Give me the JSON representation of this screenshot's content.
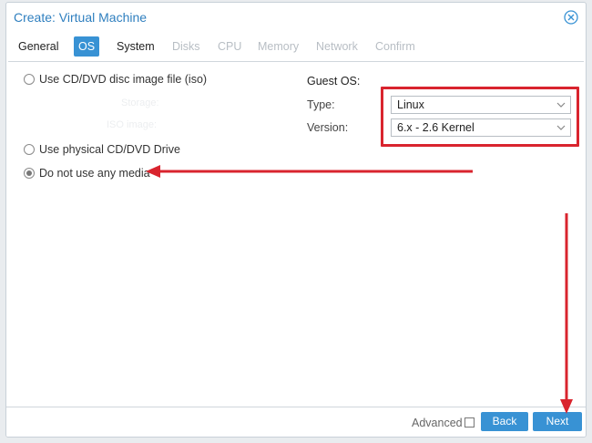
{
  "dialog": {
    "title": "Create: Virtual Machine",
    "close_icon": "close-circle-icon"
  },
  "tabs": [
    {
      "label": "General",
      "state": "enabled"
    },
    {
      "label": "OS",
      "state": "active"
    },
    {
      "label": "System",
      "state": "enabled"
    },
    {
      "label": "Disks",
      "state": "disabled"
    },
    {
      "label": "CPU",
      "state": "disabled"
    },
    {
      "label": "Memory",
      "state": "disabled"
    },
    {
      "label": "Network",
      "state": "disabled"
    },
    {
      "label": "Confirm",
      "state": "disabled"
    }
  ],
  "media": {
    "iso_label": "Use CD/DVD disc image file (iso)",
    "iso_faded_storage": "Storage:",
    "iso_faded_image": "ISO image:",
    "physical_label": "Use physical CD/DVD Drive",
    "none_label": "Do not use any media",
    "selected": "Do not use any media"
  },
  "guest_os": {
    "title": "Guest OS:",
    "type_label": "Type:",
    "type_value": "Linux",
    "version_label": "Version:",
    "version_value": "6.x - 2.6 Kernel"
  },
  "footer": {
    "advanced_label": "Advanced",
    "advanced_checked": false,
    "back_label": "Back",
    "next_label": "Next"
  },
  "colors": {
    "accent": "#3892d4",
    "title": "#2f7fbf",
    "annotation": "#d9242e"
  }
}
